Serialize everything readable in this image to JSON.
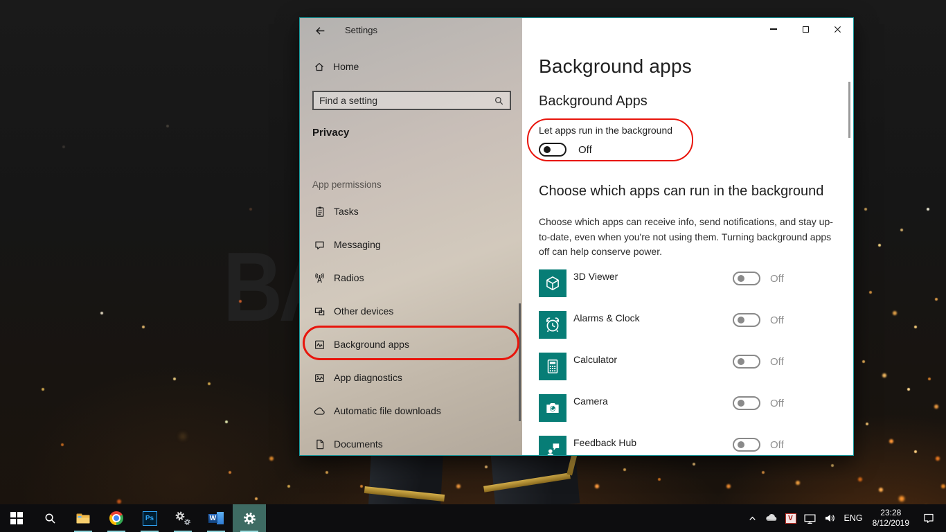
{
  "wallpaper": {
    "text": "BA"
  },
  "settings_window": {
    "titlebar": {
      "title": "Settings"
    },
    "sidebar": {
      "home_label": "Home",
      "search_placeholder": "Find a setting",
      "section_title": "Privacy",
      "group_label": "App permissions",
      "items": [
        {
          "id": "tasks",
          "label": "Tasks",
          "icon": "sym-tasks"
        },
        {
          "id": "messaging",
          "label": "Messaging",
          "icon": "sym-messaging"
        },
        {
          "id": "radios",
          "label": "Radios",
          "icon": "sym-radios"
        },
        {
          "id": "other-devices",
          "label": "Other devices",
          "icon": "sym-other-devices"
        },
        {
          "id": "background-apps",
          "label": "Background apps",
          "icon": "sym-background-apps"
        },
        {
          "id": "app-diagnostics",
          "label": "App diagnostics",
          "icon": "sym-app-diagnostics"
        },
        {
          "id": "automatic-file-downloads",
          "label": "Automatic file downloads",
          "icon": "sym-cloud"
        },
        {
          "id": "documents",
          "label": "Documents",
          "icon": "sym-documents"
        }
      ]
    },
    "content": {
      "page_title": "Background apps",
      "master_section": {
        "heading": "Background Apps",
        "toggle_label": "Let apps run in the background",
        "toggle_state": "Off"
      },
      "apps_section": {
        "heading": "Choose which apps can run in the background",
        "description": "Choose which apps can receive info, send notifications, and stay up-to-date, even when you're not using them. Turning background apps off can help conserve power.",
        "apps": [
          {
            "id": "3d-viewer",
            "name": "3D Viewer",
            "state": "Off",
            "icon": "sym-cube"
          },
          {
            "id": "alarms-clock",
            "name": "Alarms & Clock",
            "state": "Off",
            "icon": "sym-alarm"
          },
          {
            "id": "calculator",
            "name": "Calculator",
            "state": "Off",
            "icon": "sym-calc"
          },
          {
            "id": "camera",
            "name": "Camera",
            "state": "Off",
            "icon": "sym-camera"
          },
          {
            "id": "feedback-hub",
            "name": "Feedback Hub",
            "state": "Off",
            "icon": "sym-feedback"
          }
        ]
      }
    }
  },
  "taskbar": {
    "photoshop_label": "Ps",
    "word_label": "W",
    "tray": {
      "v_label": "V",
      "language": "ENG",
      "time": "23:28",
      "date": "8/12/2019"
    }
  },
  "colors": {
    "accent_teal": "#18989c",
    "annotation_red": "#e8150c",
    "tile_teal": "#077d76",
    "taskbar_underline": "#8bd3da"
  }
}
